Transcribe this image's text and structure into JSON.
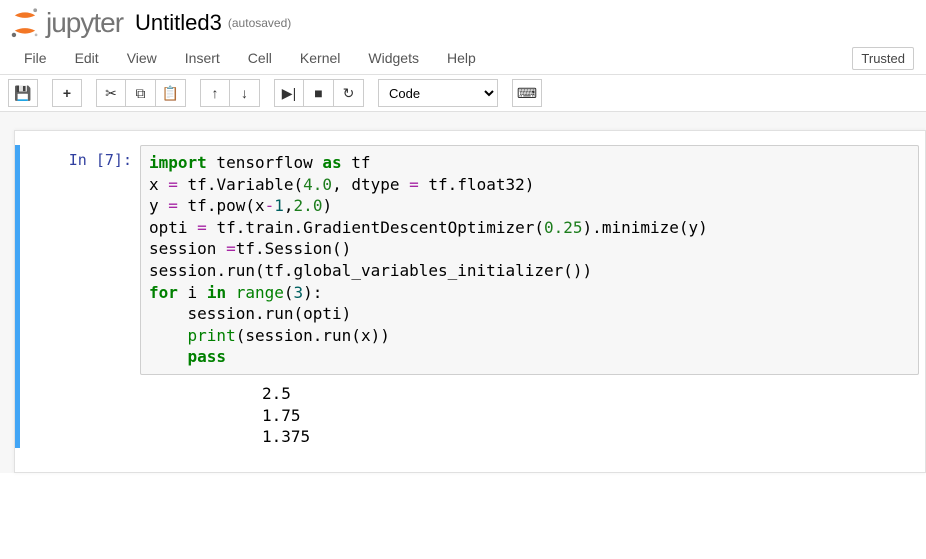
{
  "header": {
    "logo_text": "jupyter",
    "notebook_title": "Untitled3",
    "save_status": "(autosaved)"
  },
  "menubar": {
    "items": [
      "File",
      "Edit",
      "View",
      "Insert",
      "Cell",
      "Kernel",
      "Widgets",
      "Help"
    ],
    "trust_label": "Trusted"
  },
  "toolbar": {
    "save_title": "Save and Checkpoint",
    "add_title": "Insert cell below",
    "cut_title": "Cut cells",
    "copy_title": "Copy cells",
    "paste_title": "Paste cells below",
    "up_title": "Move cell up",
    "down_title": "Move cell down",
    "run_title": "Run",
    "stop_title": "Interrupt kernel",
    "restart_title": "Restart kernel",
    "cell_type_selected": "Code",
    "cmd_title": "Command palette"
  },
  "cells": [
    {
      "exec_count": 7,
      "prompt": "In [7]:",
      "source_tokens": [
        {
          "t": "import",
          "c": "kw"
        },
        {
          "t": " tensorflow "
        },
        {
          "t": "as",
          "c": "kw"
        },
        {
          "t": " tf\n"
        },
        {
          "t": "x "
        },
        {
          "t": "=",
          "c": "op"
        },
        {
          "t": " tf"
        },
        {
          "t": "."
        },
        {
          "t": "Variable("
        },
        {
          "t": "4.0",
          "c": "num"
        },
        {
          "t": ", dtype "
        },
        {
          "t": "=",
          "c": "op"
        },
        {
          "t": " tf"
        },
        {
          "t": "."
        },
        {
          "t": "float32)\n"
        },
        {
          "t": "y "
        },
        {
          "t": "=",
          "c": "op"
        },
        {
          "t": " tf"
        },
        {
          "t": "."
        },
        {
          "t": "pow(x"
        },
        {
          "t": "-",
          "c": "op"
        },
        {
          "t": "1",
          "c": "int"
        },
        {
          "t": ","
        },
        {
          "t": "2.0",
          "c": "num"
        },
        {
          "t": ")\n"
        },
        {
          "t": "opti "
        },
        {
          "t": "=",
          "c": "op"
        },
        {
          "t": " tf"
        },
        {
          "t": "."
        },
        {
          "t": "train"
        },
        {
          "t": "."
        },
        {
          "t": "GradientDescentOptimizer("
        },
        {
          "t": "0.25",
          "c": "num"
        },
        {
          "t": ")"
        },
        {
          "t": "."
        },
        {
          "t": "minimize(y)\n"
        },
        {
          "t": "session "
        },
        {
          "t": "=",
          "c": "op"
        },
        {
          "t": "tf"
        },
        {
          "t": "."
        },
        {
          "t": "Session()\n"
        },
        {
          "t": "session"
        },
        {
          "t": "."
        },
        {
          "t": "run(tf"
        },
        {
          "t": "."
        },
        {
          "t": "global_variables_initializer())\n"
        },
        {
          "t": "for",
          "c": "kw"
        },
        {
          "t": " i "
        },
        {
          "t": "in",
          "c": "kw"
        },
        {
          "t": " "
        },
        {
          "t": "range",
          "c": "bn"
        },
        {
          "t": "("
        },
        {
          "t": "3",
          "c": "int"
        },
        {
          "t": "):\n"
        },
        {
          "t": "    session"
        },
        {
          "t": "."
        },
        {
          "t": "run(opti)\n"
        },
        {
          "t": "    "
        },
        {
          "t": "print",
          "c": "bn"
        },
        {
          "t": "(session"
        },
        {
          "t": "."
        },
        {
          "t": "run(x))\n"
        },
        {
          "t": "    "
        },
        {
          "t": "pass",
          "c": "kw"
        }
      ],
      "output_text": "2.5\n1.75\n1.375"
    }
  ]
}
